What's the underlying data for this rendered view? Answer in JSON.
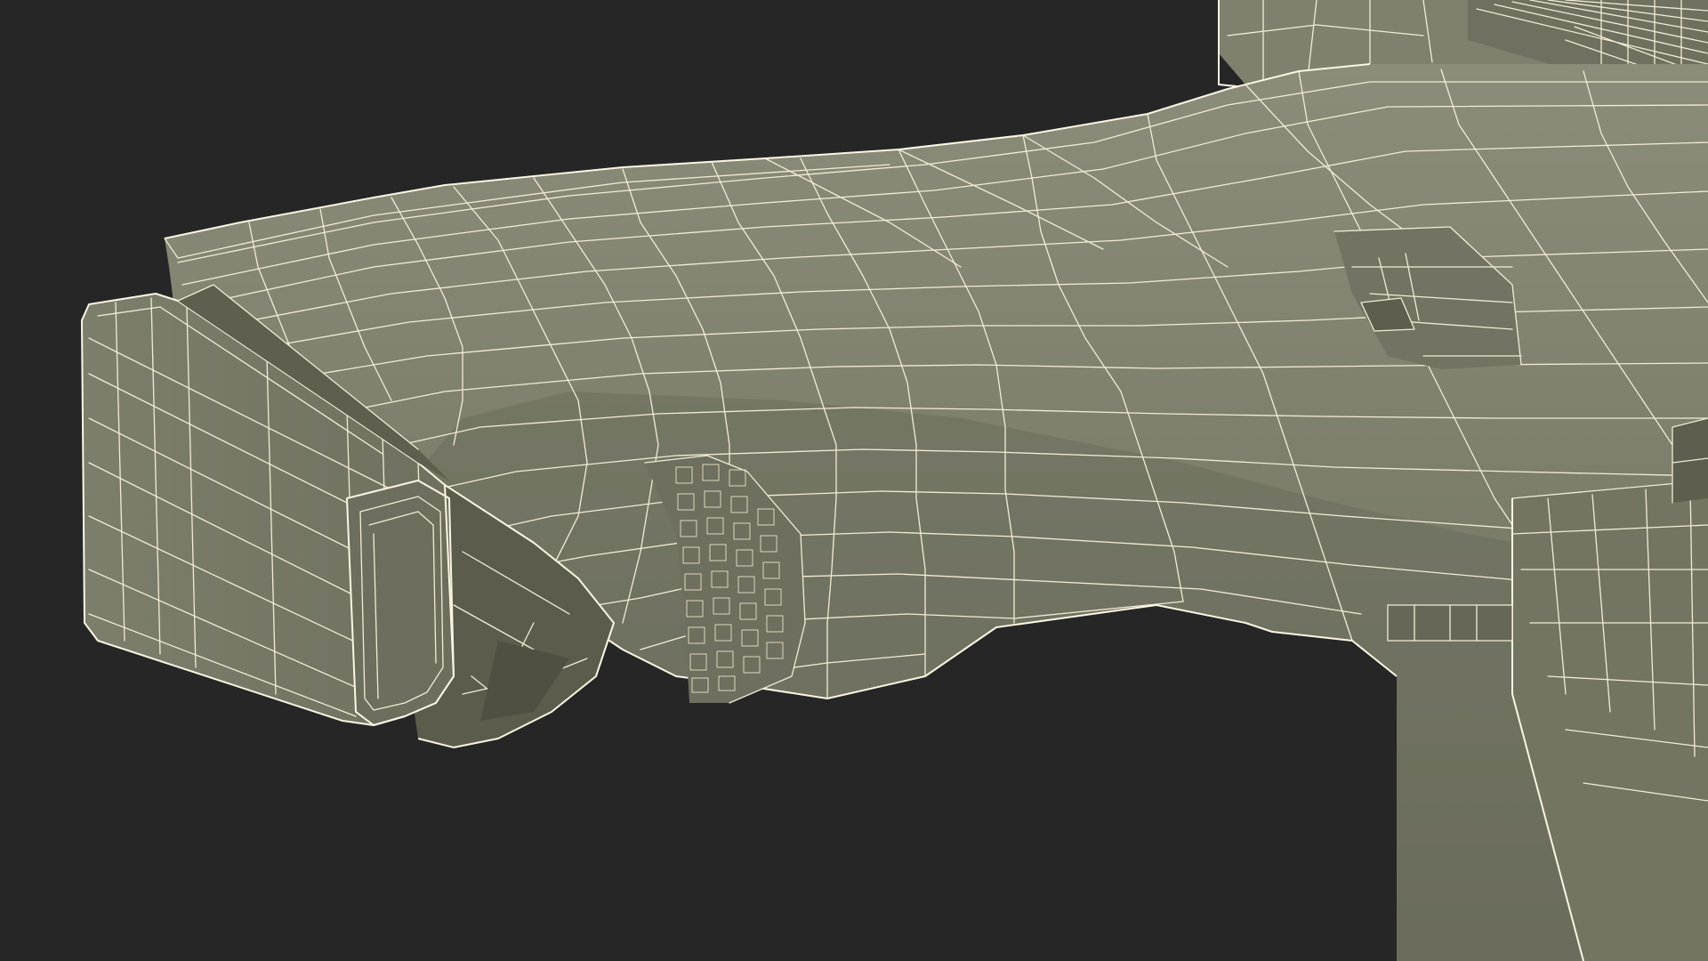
{
  "scene": {
    "subject": "3d-wireframe-pistol-grip",
    "colors": {
      "background": "#262626",
      "surface": "#7a7b69",
      "surface_light": "#8a8b78",
      "surface_dark": "#5f604f",
      "surface_shadow": "#4e4f42",
      "wire": "#f2ecd6"
    }
  }
}
